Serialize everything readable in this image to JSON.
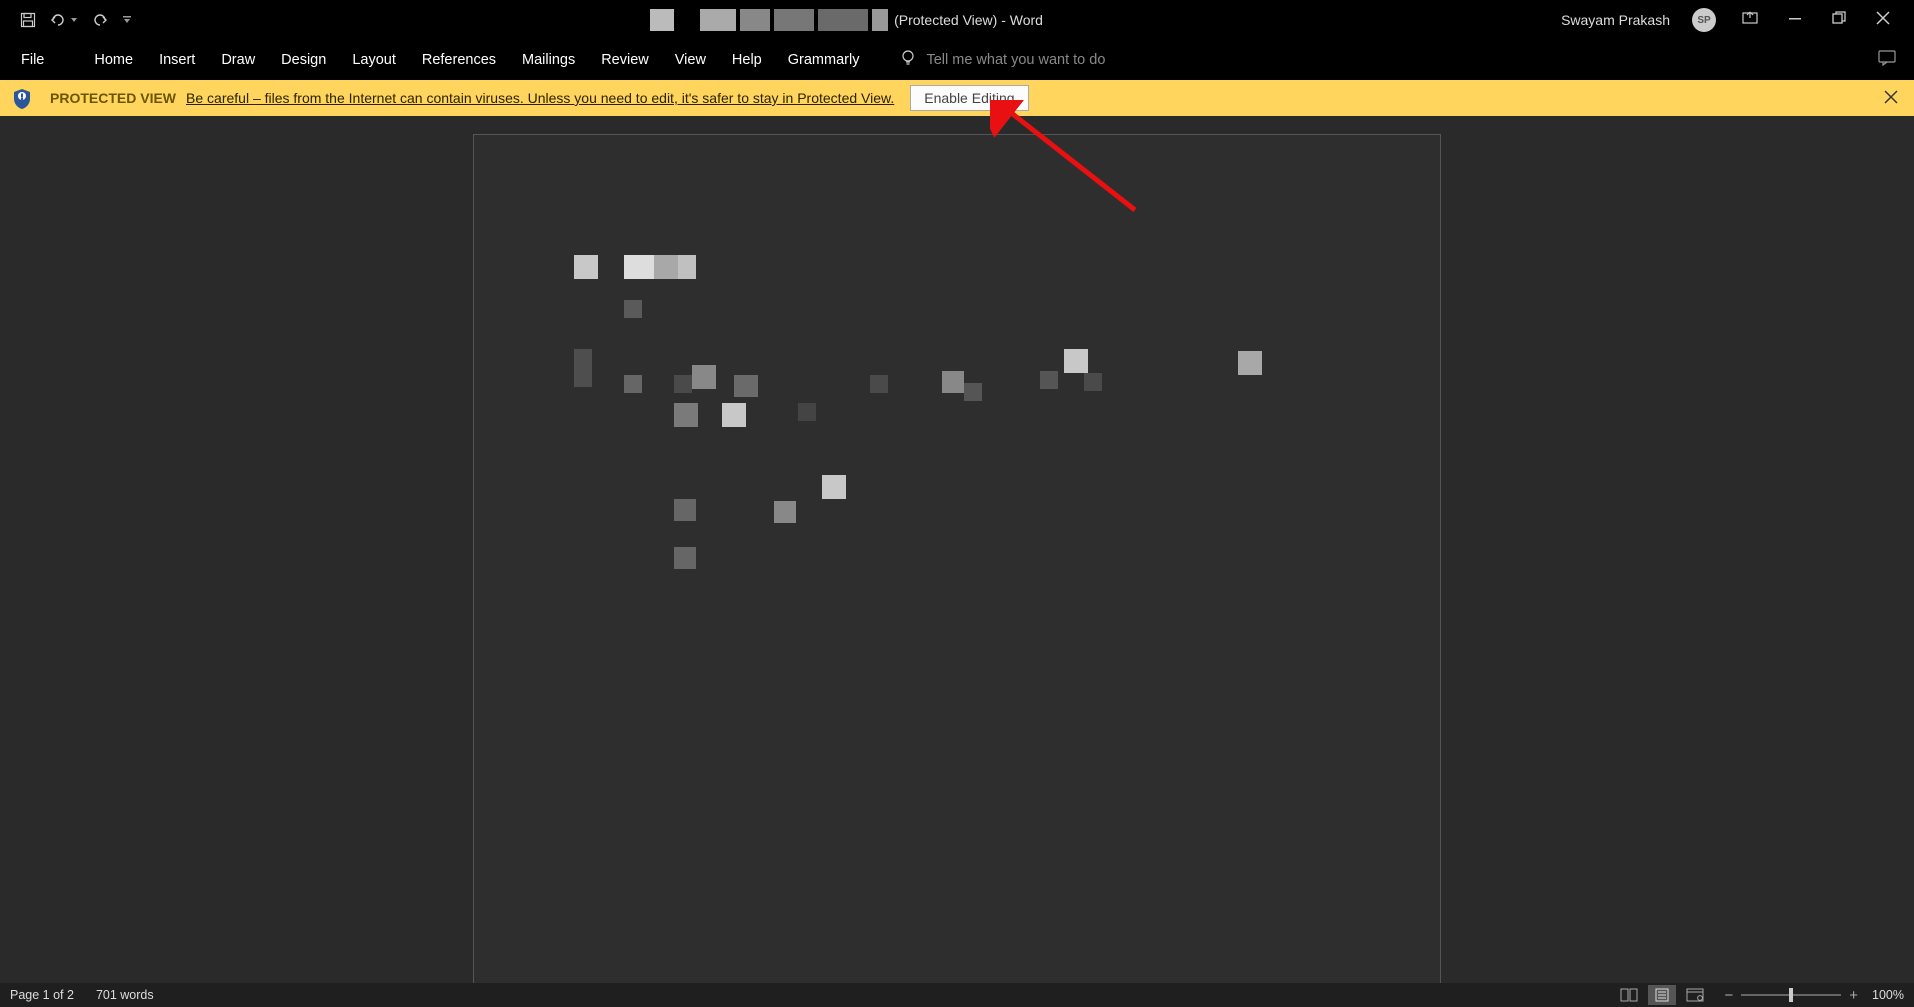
{
  "title_bar": {
    "suffix": " (Protected View)  -  Word",
    "user_name": "Swayam Prakash",
    "user_initials": "SP"
  },
  "ribbon": {
    "tabs": [
      "File",
      "Home",
      "Insert",
      "Draw",
      "Design",
      "Layout",
      "References",
      "Mailings",
      "Review",
      "View",
      "Help",
      "Grammarly"
    ],
    "tellme_placeholder": "Tell me what you want to do"
  },
  "protected_view": {
    "label": "PROTECTED VIEW",
    "message": "Be careful – files from the Internet can contain viruses. Unless you need to edit, it's safer to stay in Protected View.",
    "button": "Enable Editing"
  },
  "status_bar": {
    "page_indicator": "Page 1 of 2",
    "word_count": "701 words",
    "zoom_level": "100%",
    "zoom_minus": "−",
    "zoom_plus": "+"
  },
  "colors": {
    "banner_bg": "#ffd55e",
    "banner_text": "#2b2200",
    "arrow": "#e81010"
  }
}
